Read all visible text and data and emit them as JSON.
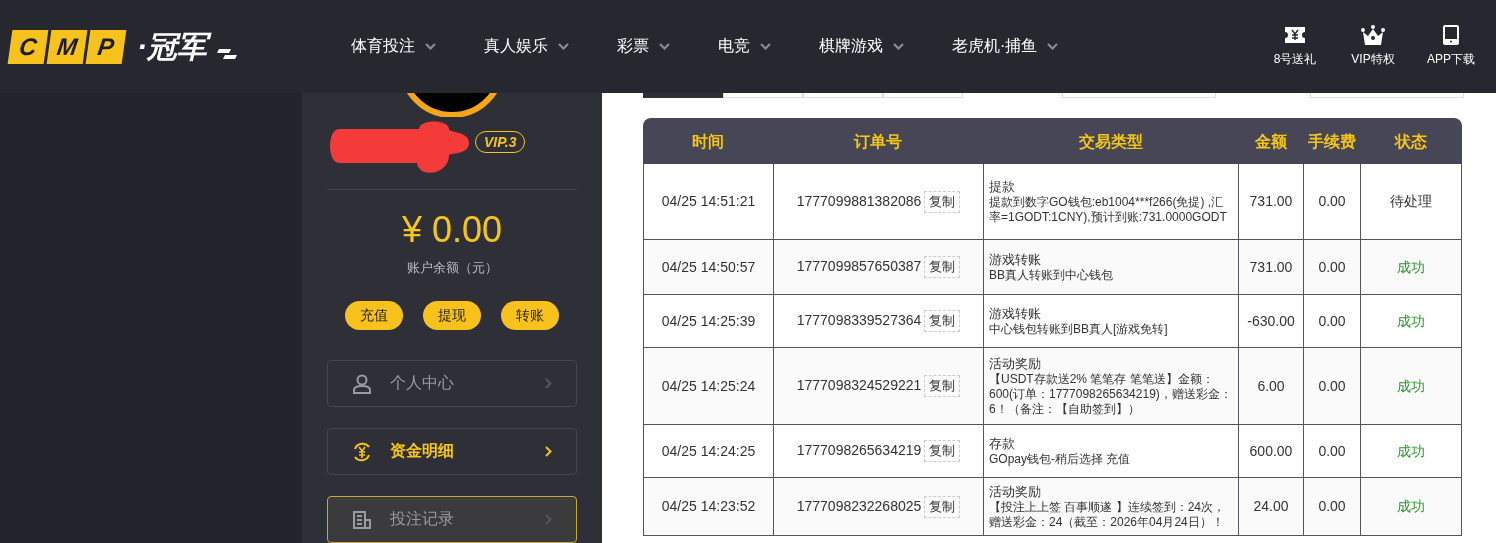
{
  "logo": {
    "letters": [
      "C",
      "M",
      "P"
    ],
    "name": "·冠军"
  },
  "nav": [
    {
      "label": "体育投注"
    },
    {
      "label": "真人娱乐"
    },
    {
      "label": "彩票"
    },
    {
      "label": "电竞"
    },
    {
      "label": "棋牌游戏"
    },
    {
      "label": "老虎机·捕鱼"
    }
  ],
  "header_links": [
    {
      "kind": "ticket",
      "label": "8号送礼"
    },
    {
      "kind": "crown",
      "label": "VIP特权"
    },
    {
      "kind": "phone",
      "label": "APP下载"
    }
  ],
  "sidebar": {
    "vip_badge": "VIP.3",
    "balance": "¥ 0.00",
    "balance_label": "账户余额（元）",
    "actions": [
      "充值",
      "提现",
      "转账"
    ],
    "menu": [
      {
        "kind": "user",
        "label": "个人中心",
        "selected": false,
        "hovered": false
      },
      {
        "kind": "money",
        "label": "资金明细",
        "selected": true,
        "hovered": false
      },
      {
        "kind": "doc",
        "label": "投注记录",
        "selected": false,
        "hovered": true
      }
    ]
  },
  "filter_tabs": [
    {
      "selected": true
    },
    {
      "selected": false
    },
    {
      "selected": false
    },
    {
      "selected": false
    }
  ],
  "table": {
    "columns": [
      "时间",
      "订单号",
      "交易类型",
      "金额",
      "手续费",
      "状态"
    ],
    "rows": [
      {
        "time": "04/25 14:51:21",
        "order": "1777099881382086",
        "copy_label": "复制",
        "type": "提款",
        "detail": "提款到数字GO钱包:eb1004***f266(免提) ,汇率=1GODT:1CNY),预计到账:731.0000GODT",
        "amount": "731.00",
        "fee": "0.00",
        "status": "待处理",
        "kind": "pending"
      },
      {
        "time": "04/25 14:50:57",
        "order": "1777099857650387",
        "copy_label": "复制",
        "type": "游戏转账",
        "detail": "BB真人转账到中心钱包",
        "amount": "731.00",
        "fee": "0.00",
        "status": "成功",
        "kind": "success"
      },
      {
        "time": "04/25 14:25:39",
        "order": "1777098339527364",
        "copy_label": "复制",
        "type": "游戏转账",
        "detail": "中心钱包转账到BB真人[游戏免转]",
        "amount": "-630.00",
        "fee": "0.00",
        "status": "成功",
        "kind": "success"
      },
      {
        "time": "04/25 14:25:24",
        "order": "1777098324529221",
        "copy_label": "复制",
        "type": "活动奖励",
        "detail": "【USDT存款送2% 笔笔存 笔笔送】金额：600(订单：1777098265634219)，赠送彩金：6！（备注：【自助签到】）",
        "amount": "6.00",
        "fee": "0.00",
        "status": "成功",
        "kind": "success"
      },
      {
        "time": "04/25 14:24:25",
        "order": "1777098265634219",
        "copy_label": "复制",
        "type": "存款",
        "detail": "GOpay钱包-稍后选择 充值",
        "amount": "600.00",
        "fee": "0.00",
        "status": "成功",
        "kind": "success"
      },
      {
        "time": "04/25 14:23:52",
        "order": "1777098232268025",
        "copy_label": "复制",
        "type": "活动奖励",
        "detail": "【投注上上签 百事顺遂 】连续签到：24次，赠送彩金：24（截至：2026年04月24日）！",
        "amount": "24.00",
        "fee": "0.00",
        "status": "成功",
        "kind": "success"
      }
    ]
  }
}
